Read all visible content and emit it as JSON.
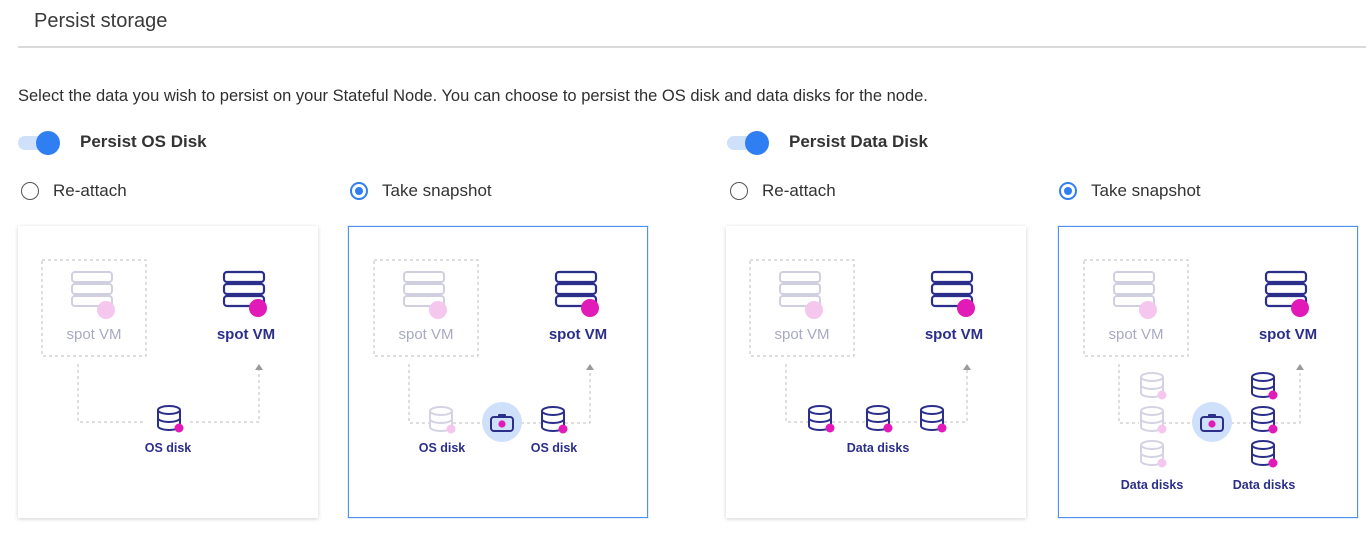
{
  "section": {
    "title": "Persist storage"
  },
  "description": "Select the data you wish to persist on your Stateful Node. You can choose to persist the OS disk and data disks for the node.",
  "colors": {
    "accent": "#2f7ff2",
    "navy": "#2b2f8a",
    "magenta": "#e21bb8",
    "faded": "#c9c9dc"
  },
  "os_disk": {
    "toggle_label": "Persist OS Disk",
    "toggle_on": true,
    "options": [
      {
        "label": "Re-attach",
        "checked": false
      },
      {
        "label": "Take snapshot",
        "checked": true
      }
    ],
    "cards": [
      {
        "source_label": "spot VM",
        "target_label": "spot VM",
        "disk_label": "OS disk"
      },
      {
        "source_label": "spot VM",
        "target_label": "spot VM",
        "left_disk_label": "OS disk",
        "right_disk_label": "OS disk",
        "camera_icon": "camera-icon"
      }
    ]
  },
  "data_disk": {
    "toggle_label": "Persist Data Disk",
    "toggle_on": true,
    "options": [
      {
        "label": "Re-attach",
        "checked": false
      },
      {
        "label": "Take snapshot",
        "checked": true
      }
    ],
    "cards": [
      {
        "source_label": "spot VM",
        "target_label": "spot VM",
        "disk_label": "Data disks"
      },
      {
        "source_label": "spot VM",
        "target_label": "spot VM",
        "left_disk_label": "Data disks",
        "right_disk_label": "Data disks",
        "camera_icon": "camera-icon"
      }
    ]
  }
}
